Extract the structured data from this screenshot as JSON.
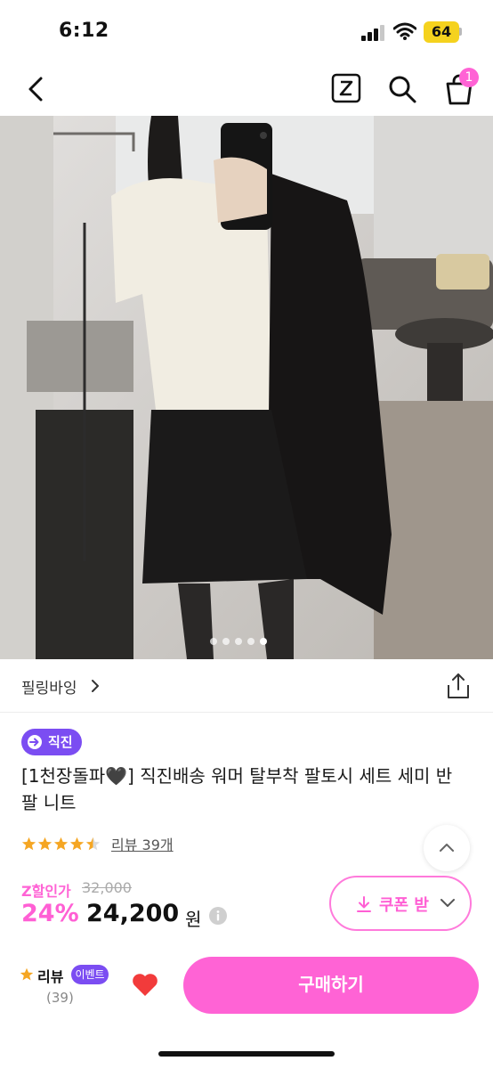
{
  "status_bar": {
    "time": "6:12",
    "battery": "64"
  },
  "header": {
    "cart_count": "1",
    "icons": [
      "back-chevron-icon",
      "z-logo-icon",
      "search-icon",
      "shopping-bag-icon"
    ]
  },
  "gallery": {
    "image_count": 5,
    "active_index": 4
  },
  "brand": {
    "name": "필링바잉"
  },
  "product": {
    "badge": "직진",
    "title": "[1천장돌파🖤] 직진배송 워머 탈부착 팔토시 세트 세미 반팔 니트",
    "rating": 4.5,
    "review_link": "리뷰 39개"
  },
  "price": {
    "discount_label": "Z할인가",
    "original": "32,000",
    "discount_rate": "24%",
    "sale": "24,200",
    "currency": "원"
  },
  "coupon": {
    "label": "쿠폰 받"
  },
  "bottom_bar": {
    "review_label": "리뷰",
    "event_label": "이벤트",
    "review_count": "(39)",
    "buy_label": "구매하기"
  },
  "colors": {
    "accent_pink": "#ff63d5",
    "badge_purple": "#7b4df2",
    "star": "#f5a623",
    "heart": "#f23b3b"
  }
}
